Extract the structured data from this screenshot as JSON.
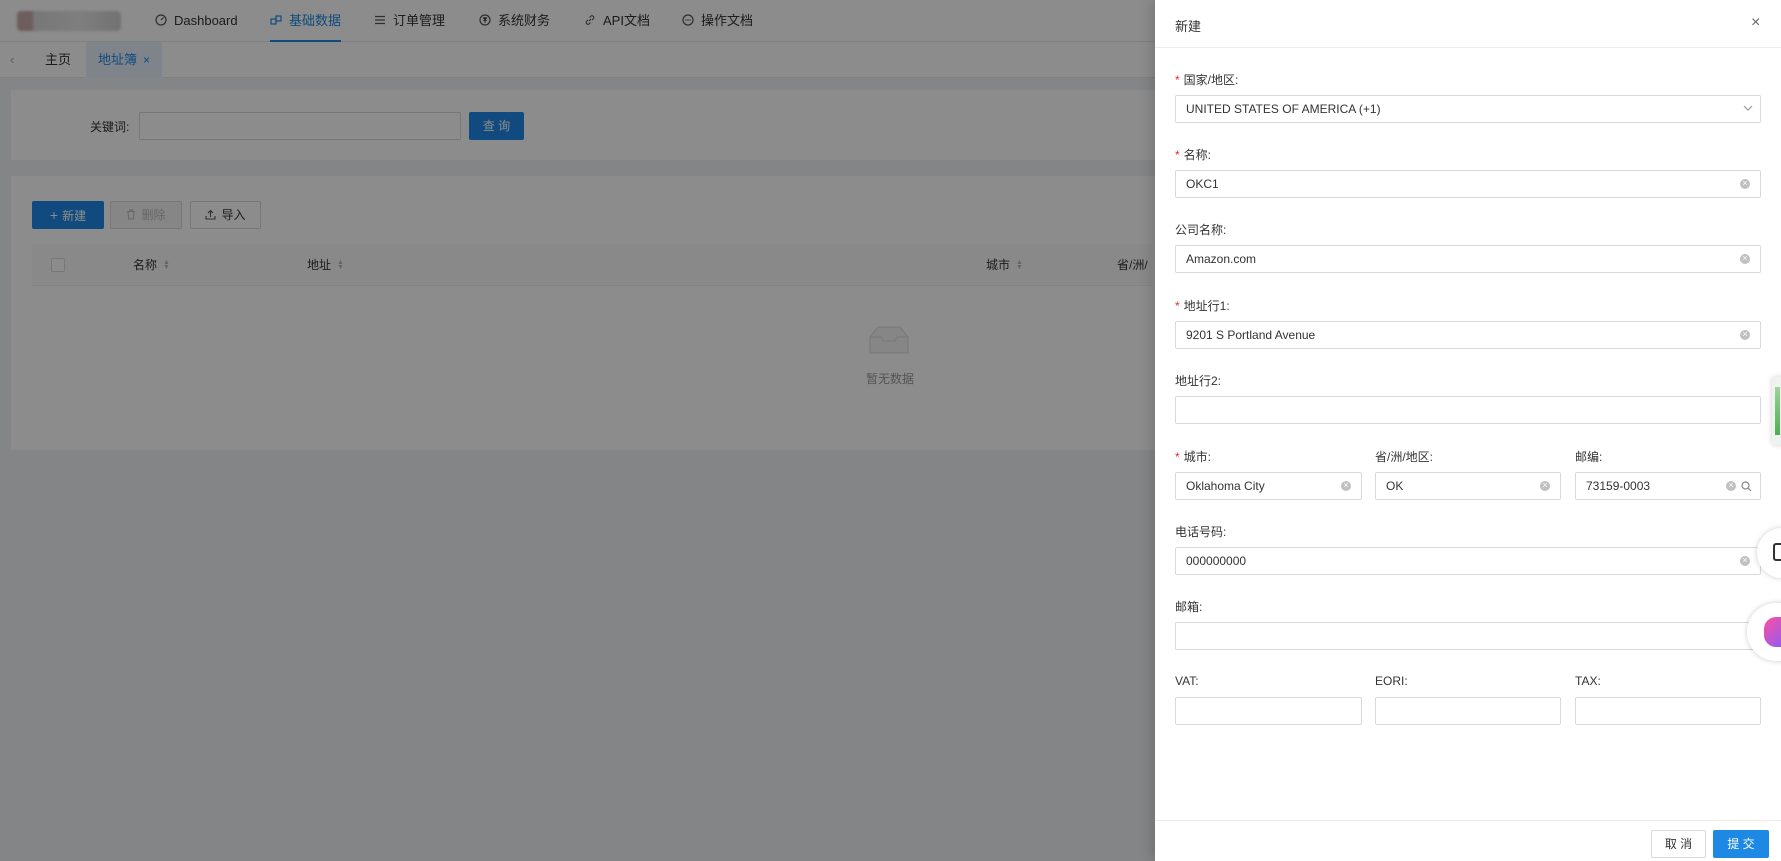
{
  "nav": {
    "items": [
      {
        "label": "Dashboard",
        "icon": "dashboard-icon"
      },
      {
        "label": "基础数据",
        "icon": "data-icon"
      },
      {
        "label": "订单管理",
        "icon": "list-icon"
      },
      {
        "label": "系统财务",
        "icon": "finance-icon"
      },
      {
        "label": "API文档",
        "icon": "link-icon"
      },
      {
        "label": "操作文档",
        "icon": "doc-icon"
      }
    ]
  },
  "tabs": {
    "home": "主页",
    "active": "地址簿",
    "close": "×"
  },
  "search": {
    "label": "关键词:",
    "button": "查 询"
  },
  "toolbar": {
    "new": "新建",
    "delete": "删除",
    "import": "导入"
  },
  "table": {
    "columns": [
      "名称",
      "地址",
      "城市",
      "省/洲/"
    ],
    "empty": "暂无数据"
  },
  "drawer": {
    "title": "新建",
    "close": "×",
    "fields": {
      "country": {
        "label": "国家/地区:",
        "value": "UNITED STATES OF AMERICA (+1)"
      },
      "name": {
        "label": "名称:",
        "value": "OKC1"
      },
      "company": {
        "label": "公司名称:",
        "value": "Amazon.com"
      },
      "address1": {
        "label": "地址行1:",
        "value": "9201 S Portland Avenue"
      },
      "address2": {
        "label": "地址行2:",
        "value": ""
      },
      "city": {
        "label": "城市:",
        "value": "Oklahoma City"
      },
      "state": {
        "label": "省/洲/地区:",
        "value": "OK"
      },
      "zip": {
        "label": "邮编:",
        "value": "73159-0003"
      },
      "phone": {
        "label": "电话号码:",
        "value": "000000000"
      },
      "email": {
        "label": "邮箱:",
        "value": ""
      },
      "vat": {
        "label": "VAT:",
        "value": ""
      },
      "eori": {
        "label": "EORI:",
        "value": ""
      },
      "tax": {
        "label": "TAX:",
        "value": ""
      }
    },
    "required_mark": "*",
    "cancel": "取 消",
    "submit": "提 交"
  },
  "colors": {
    "primary": "#1e88e5",
    "required": "#f5222d"
  }
}
